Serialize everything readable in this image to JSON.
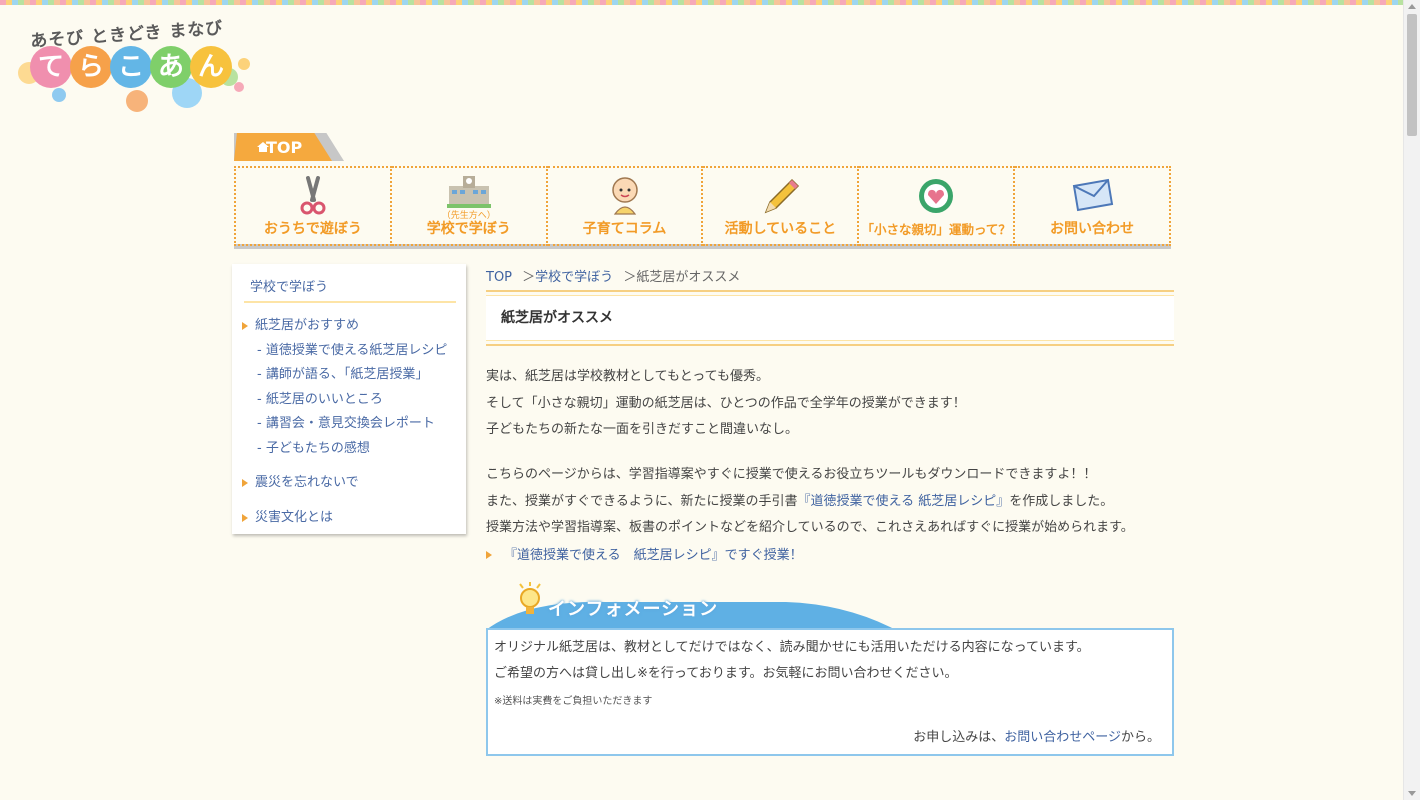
{
  "logo": {
    "tagline": "あそび ときどき まなび",
    "letters": [
      "て",
      "ら",
      "こ",
      "あ",
      "ん"
    ],
    "colors": [
      "#f08fae",
      "#f6a14a",
      "#63b6e6",
      "#7fcf6a",
      "#f7c23d"
    ]
  },
  "top_tab": {
    "label": "TOP"
  },
  "nav": [
    {
      "label": "おうちで遊ぼう",
      "icon": "scissors-icon"
    },
    {
      "label": "学校で学ぼう",
      "sub": "（先生方へ）",
      "icon": "school-building-icon"
    },
    {
      "label": "子育てコラム",
      "icon": "baby-icon"
    },
    {
      "label": "活動していること",
      "icon": "pencil-icon"
    },
    {
      "label": "「小さな親切」運動って？",
      "icon": "heart-emblem-icon"
    },
    {
      "label": "お問い合わせ",
      "icon": "envelope-icon"
    }
  ],
  "sidebar": {
    "title": "学校で学ぼう",
    "items": [
      {
        "label": "紙芝居がおすすめ",
        "type": "main"
      },
      {
        "label": "- 道徳授業で使える紙芝居レシピ",
        "type": "sub"
      },
      {
        "label": "- 講師が語る、「紙芝居授業」",
        "type": "sub"
      },
      {
        "label": "- 紙芝居のいいところ",
        "type": "sub"
      },
      {
        "label": "- 講習会・意見交換会レポート",
        "type": "sub"
      },
      {
        "label": "- 子どもたちの感想",
        "type": "sub"
      },
      {
        "label": "震災を忘れないで",
        "type": "main"
      },
      {
        "label": "災害文化とは",
        "type": "main"
      }
    ]
  },
  "breadcrumb": {
    "top": "TOP",
    "sep1": "＞",
    "section": "学校で学ぼう",
    "sep2": "＞",
    "current": "紙芝居がオススメ"
  },
  "page_title": "紙芝居がオススメ",
  "intro": {
    "line1": "実は、紙芝居は学校教材としてもとっても優秀。",
    "line2": "そして「小さな親切」運動の紙芝居は、ひとつの作品で全学年の授業ができます！",
    "line3": "子どもたちの新たな一面を引きだすこと間違いなし。"
  },
  "body": {
    "line1": "こちらのページからは、学習指導案やすぐに授業で使えるお役立ちツールもダウンロードできますよ！！",
    "line2_pre": "また、授業がすぐできるように、新たに授業の手引書",
    "line2_link": "『道徳授業で使える 紙芝居レシピ』",
    "line2_post": "を作成しました。",
    "line3": "授業方法や学習指導案、板書のポイントなどを紹介しているので、これさえあればすぐに授業が始められます。"
  },
  "recipe_link": "『道徳授業で使える　紙芝居レシピ』ですぐ授業！",
  "info": {
    "title": "インフォメーション",
    "line1": "オリジナル紙芝居は、教材としてだけではなく、読み聞かせにも活用いただける内容になっています。",
    "line2": "ご希望の方へは貸し出し※を行っております。お気軽にお問い合わせください。",
    "note": "※送料は実費をご負担いただきます",
    "apply_pre": "お申し込みは、",
    "apply_link": "お問い合わせページ",
    "apply_post": "から。"
  },
  "colors": {
    "accent": "#f29b27",
    "link": "#3f62a0",
    "info_blue": "#5fb0e4",
    "background": "#fdfbf1"
  }
}
